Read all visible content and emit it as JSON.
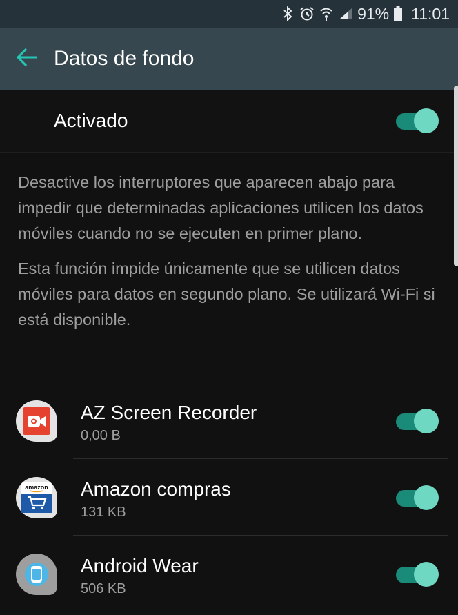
{
  "status_bar": {
    "battery_percent": "91%",
    "time": "11:01",
    "icons": [
      "bluetooth-icon",
      "alarm-icon",
      "wifi-icon",
      "signal-icon",
      "battery-icon"
    ]
  },
  "app_bar": {
    "title": "Datos de fondo",
    "back_icon": "arrow-back-icon",
    "accent_color": "#26c6b4"
  },
  "master_toggle": {
    "label": "Activado",
    "state": true
  },
  "description": {
    "paragraph1": "Desactive los interruptores que aparecen abajo para impedir que determinadas aplicaciones utilicen los datos móviles cuando no se ejecuten en primer plano.",
    "paragraph2": "Esta función impide únicamente que se utilicen datos móviles para datos en segundo plano. Se utilizará Wi-Fi si está disponible."
  },
  "apps": [
    {
      "name": "AZ Screen Recorder",
      "size": "0,00 B",
      "enabled": true,
      "icon": "az-recorder-icon"
    },
    {
      "name": "Amazon compras",
      "size": "131 KB",
      "enabled": true,
      "icon": "amazon-cart-icon",
      "icon_text": "amazon"
    },
    {
      "name": "Android Wear",
      "size": "506 KB",
      "enabled": true,
      "icon": "android-wear-icon"
    }
  ],
  "colors": {
    "toggle_on_track": "#1b8b79",
    "toggle_on_thumb": "#6fd8c3",
    "app_bar": "#37474f",
    "background": "#111111"
  }
}
